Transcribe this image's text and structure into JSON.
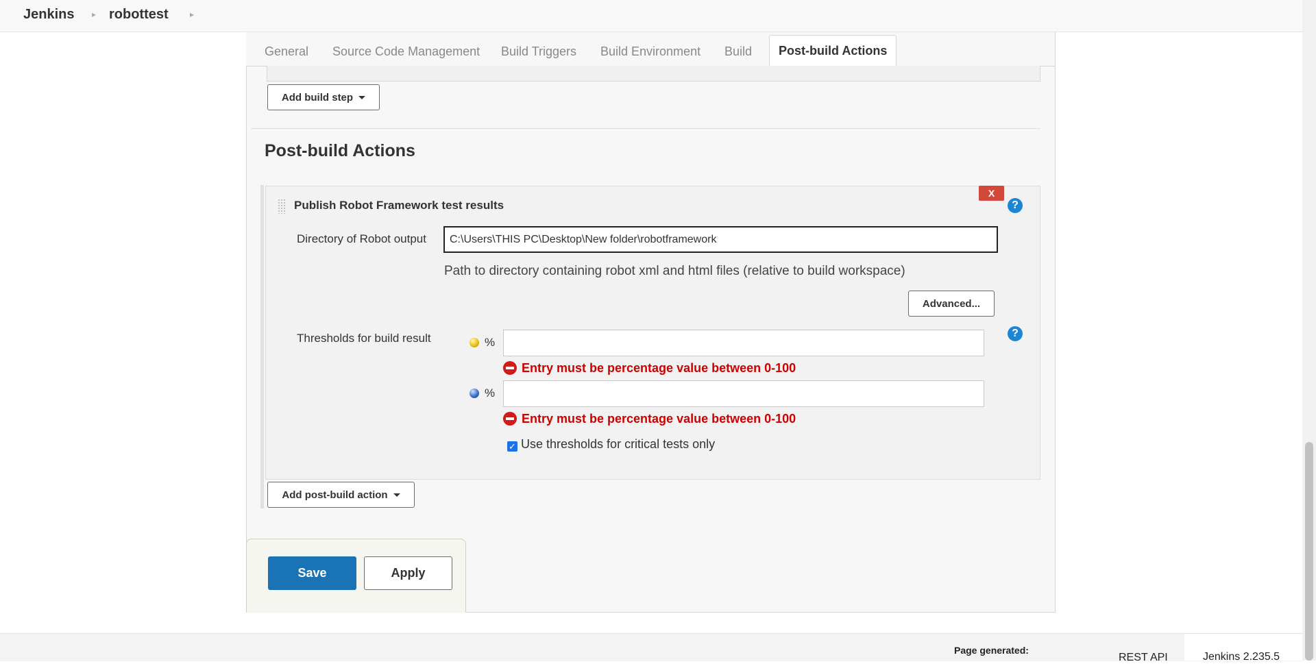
{
  "breadcrumb": {
    "items": [
      "Jenkins",
      "robottest"
    ]
  },
  "tabs": [
    "General",
    "Source Code Management",
    "Build Triggers",
    "Build Environment",
    "Build",
    "Post-build Actions"
  ],
  "build": {
    "add_step_label": "Add build step"
  },
  "post_build": {
    "title": "Post-build Actions",
    "robot": {
      "title": "Publish Robot Framework test results",
      "delete_label": "X",
      "help_label": "?",
      "output_dir_label": "Directory of Robot output",
      "output_dir_value": "C:\\Users\\THIS PC\\Desktop\\New folder\\robotframework",
      "output_dir_hint": "Path to directory containing robot xml and html files (relative to build workspace)",
      "advanced_label": "Advanced...",
      "thresholds_label": "Thresholds for build result",
      "percent_symbol": "%",
      "unstable_value": "",
      "pass_value": "",
      "error_text": "Entry must be percentage value between 0-100",
      "critical_only_label": "Use thresholds for critical tests only",
      "critical_only_checked": true
    },
    "add_action_label": "Add post-build action"
  },
  "actions": {
    "save_label": "Save",
    "apply_label": "Apply"
  },
  "footer": {
    "page_generated": "Page generated:",
    "rest_api": "REST API",
    "version": "Jenkins 2.235.5"
  },
  "colors": {
    "primary_button": "#1a73b5",
    "error": "#cc0000",
    "delete_button": "#d24939",
    "help_icon": "#1c86d6"
  }
}
